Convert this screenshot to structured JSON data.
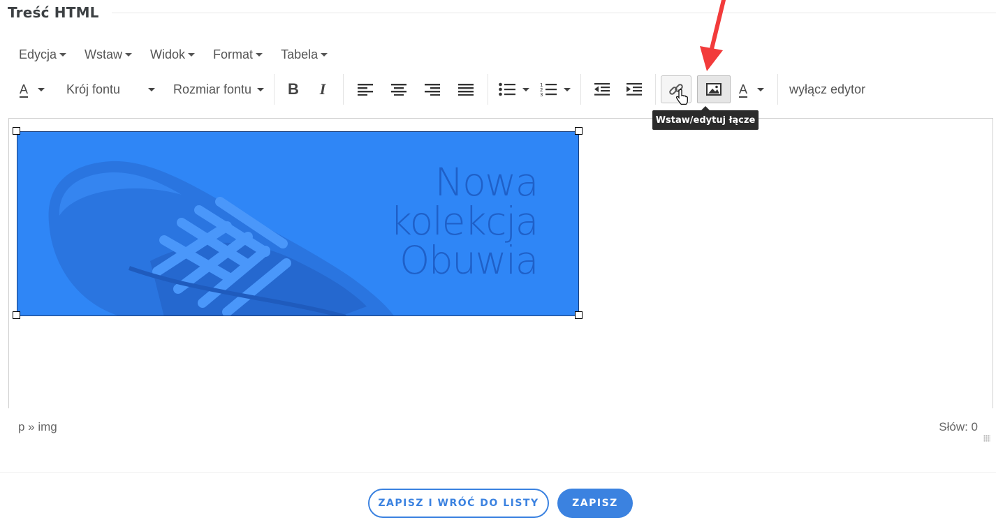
{
  "section": {
    "title": "Treść HTML"
  },
  "menubar": {
    "items": [
      {
        "label": "Edycja"
      },
      {
        "label": "Wstaw"
      },
      {
        "label": "Widok"
      },
      {
        "label": "Format"
      },
      {
        "label": "Tabela"
      }
    ]
  },
  "toolbar": {
    "text_color_glyph": "A",
    "font_family_label": "Krój fontu",
    "font_size_label": "Rozmiar fontu",
    "bold_glyph": "B",
    "italic_glyph": "I",
    "bg_color_glyph": "A",
    "disable_editor_label": "wyłącz edytor",
    "link_tooltip": "Wstaw/edytuj łącze",
    "icons": [
      "align-left-icon",
      "align-center-icon",
      "align-right-icon",
      "align-justify-icon",
      "bullet-list-icon",
      "numbered-list-icon",
      "outdent-icon",
      "indent-icon",
      "link-icon",
      "image-icon"
    ]
  },
  "editor": {
    "banner": {
      "line1": "Nowa",
      "line2": "kolekcja",
      "line3": "Obuwia",
      "background": "#2f86f6"
    }
  },
  "statusbar": {
    "path": "p » img",
    "word_count": "Słów: 0"
  },
  "actions": {
    "save_and_back": "ZAPISZ I WRÓĆ DO LISTY",
    "save": "ZAPISZ"
  },
  "colors": {
    "accent": "#3b82e0",
    "annotation_arrow": "#f23b3b"
  }
}
